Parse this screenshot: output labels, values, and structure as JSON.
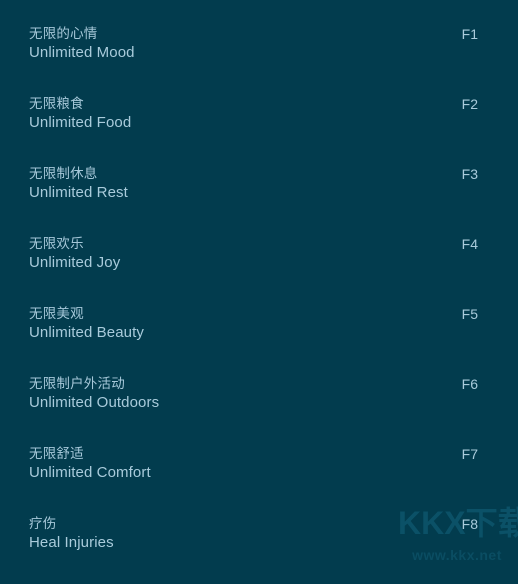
{
  "panel": {
    "background_color": "#023c4e",
    "text_color": "#a9cbdb"
  },
  "cheats": [
    {
      "name_cn": "无限的心情",
      "name_en": "Unlimited Mood",
      "hotkey": "F1"
    },
    {
      "name_cn": "无限粮食",
      "name_en": "Unlimited Food",
      "hotkey": "F2"
    },
    {
      "name_cn": "无限制休息",
      "name_en": "Unlimited Rest",
      "hotkey": "F3"
    },
    {
      "name_cn": "无限欢乐",
      "name_en": "Unlimited Joy",
      "hotkey": "F4"
    },
    {
      "name_cn": "无限美观",
      "name_en": "Unlimited Beauty",
      "hotkey": "F5"
    },
    {
      "name_cn": "无限制户外活动",
      "name_en": "Unlimited Outdoors",
      "hotkey": "F6"
    },
    {
      "name_cn": "无限舒适",
      "name_en": "Unlimited Comfort",
      "hotkey": "F7"
    },
    {
      "name_cn": "疗伤",
      "name_en": "Heal Injuries",
      "hotkey": "F8"
    }
  ],
  "watermark": {
    "logo": "KKX下载",
    "url": "www.kkx.net"
  }
}
